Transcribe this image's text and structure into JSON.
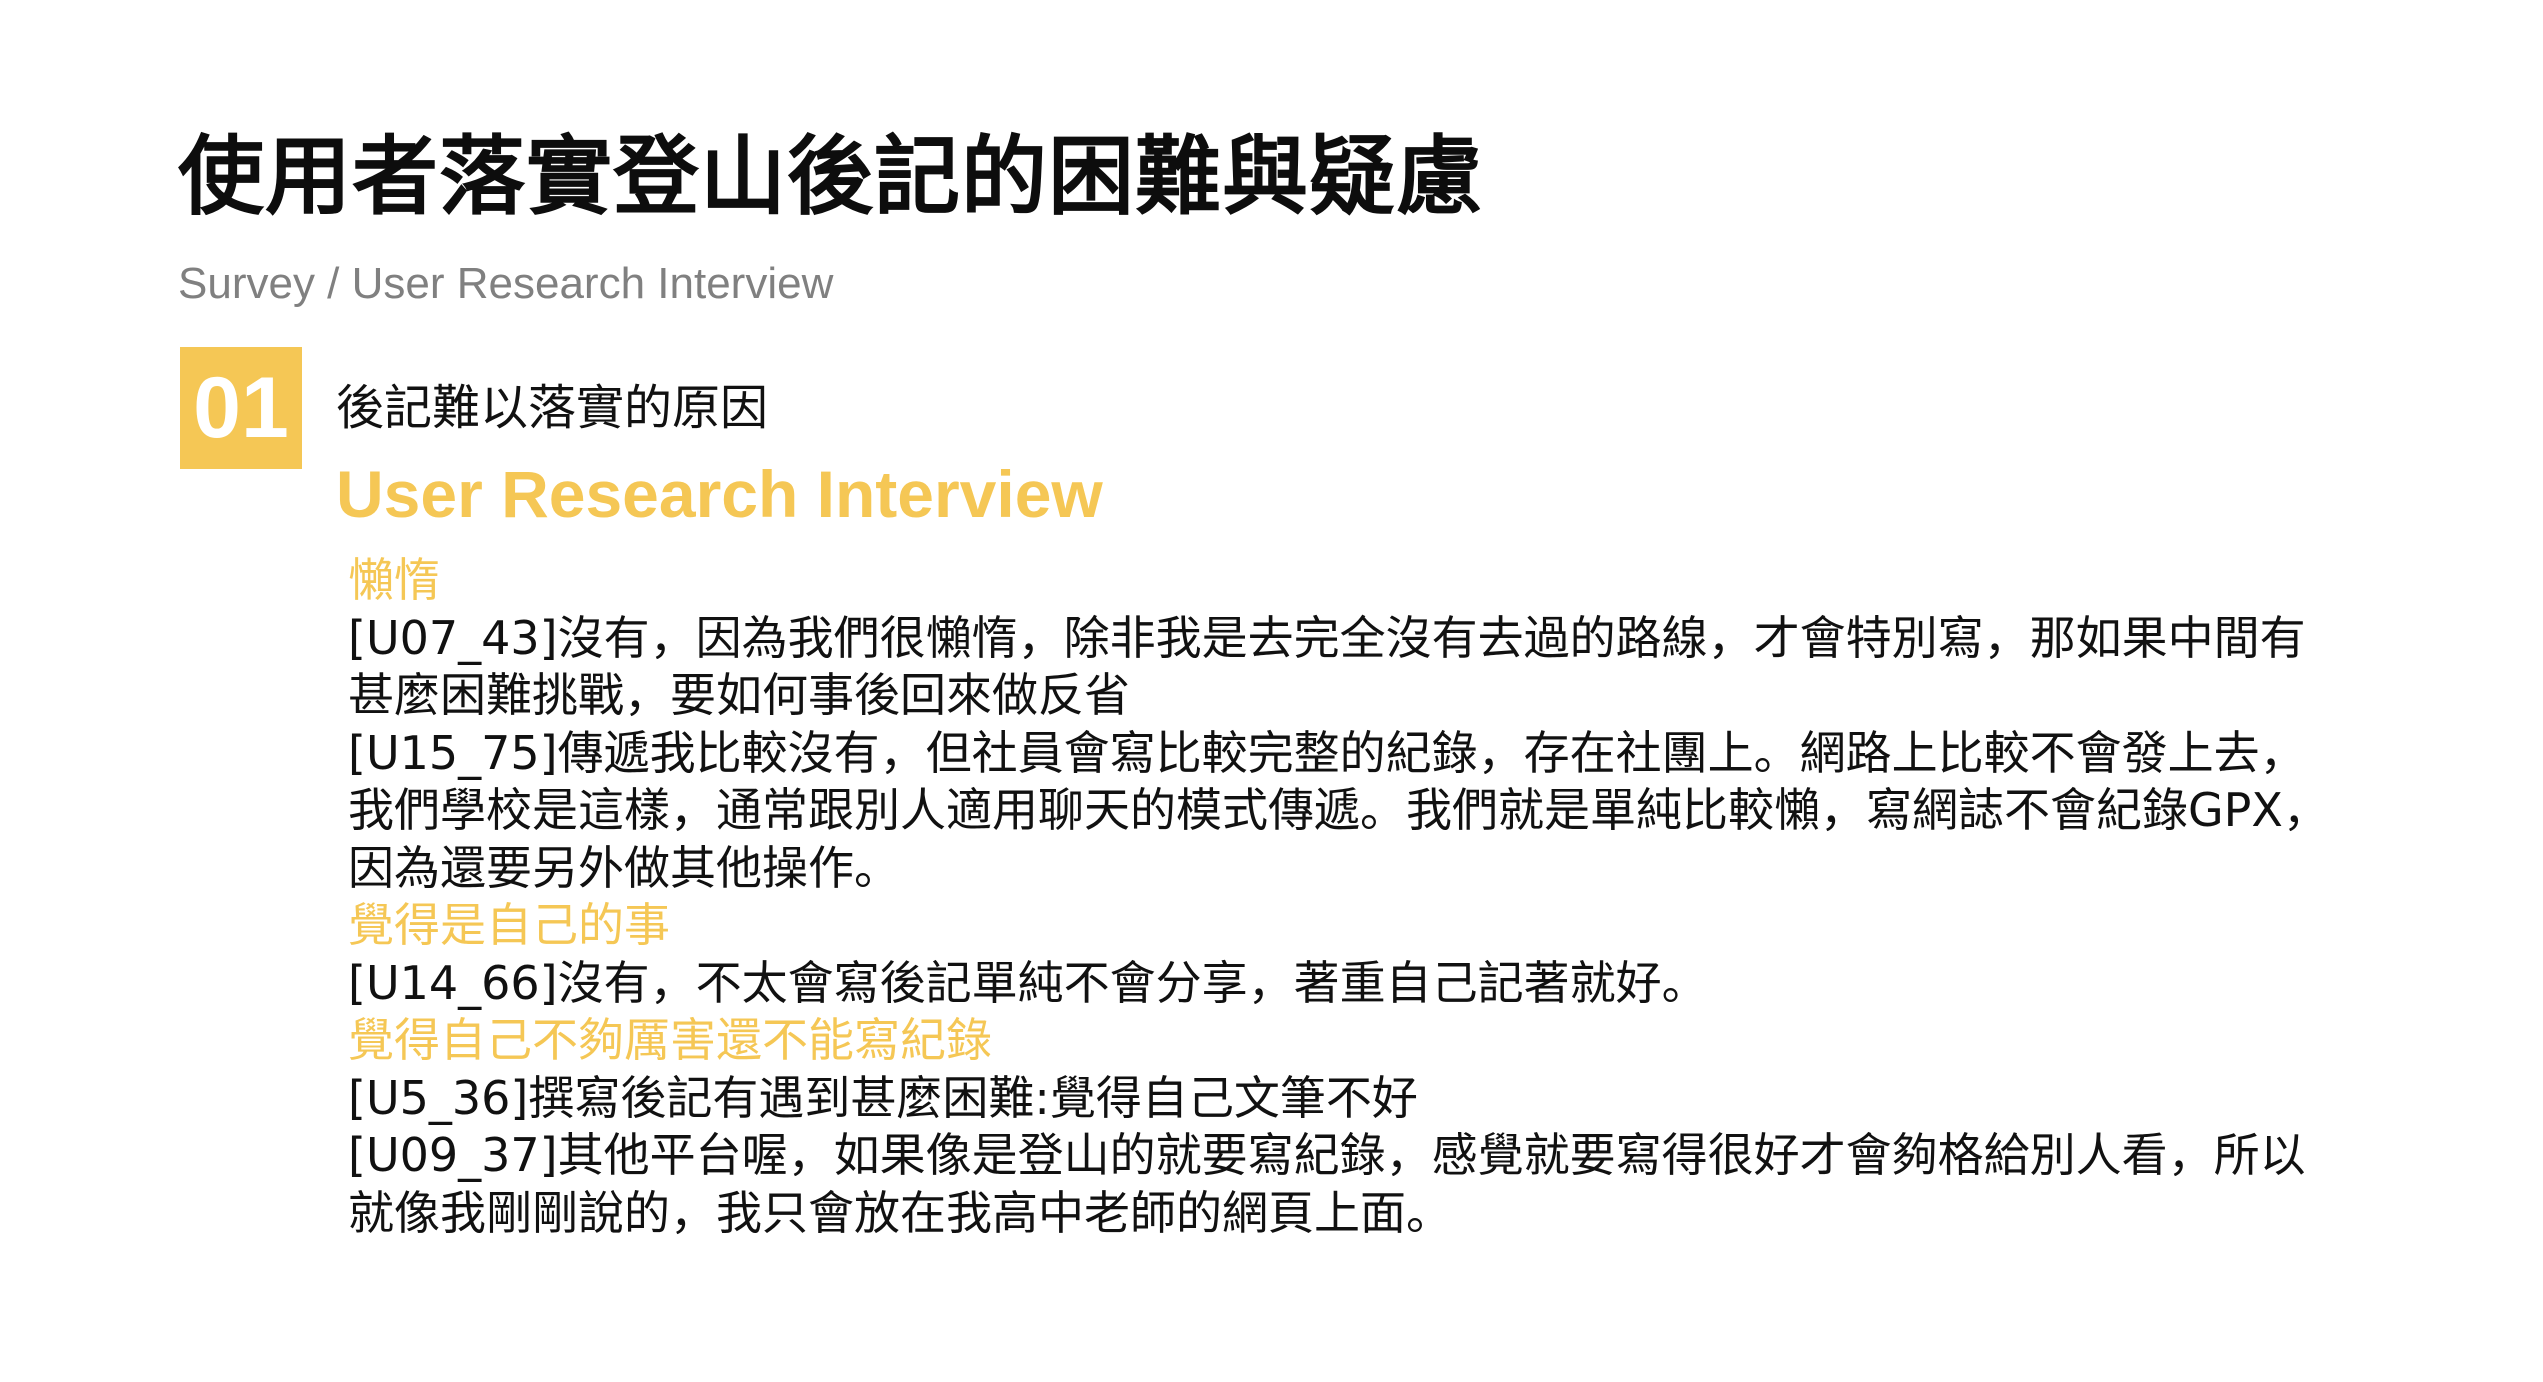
{
  "header": {
    "title": "使用者落實登山後記的困難與疑慮",
    "breadcrumb": "Survey / User Research Interview"
  },
  "section": {
    "number": "01",
    "title": "後記難以落實的原因",
    "subtitle": "User Research Interview"
  },
  "groups": [
    {
      "category": "懶惰",
      "quotes": [
        "[U07_43]沒有，因為我們很懶惰，除非我是去完全沒有去過的路線，才會特別寫，那如果中間有甚麼困難挑戰，要如何事後回來做反省",
        "[U15_75]傳遞我比較沒有，但社員會寫比較完整的紀錄，存在社團上。網路上比較不會發上去，我們學校是這樣，通常跟別人適用聊天的模式傳遞。我們就是單純比較懶，寫網誌不會紀錄GPX，因為還要另外做其他操作。"
      ]
    },
    {
      "category": "覺得是自己的事",
      "quotes": [
        "[U14_66]沒有，不太會寫後記單純不會分享，著重自己記著就好。"
      ]
    },
    {
      "category": "覺得自己不夠厲害還不能寫紀錄",
      "quotes": [
        "[U5_36]撰寫後記有遇到甚麼困難:覺得自己文筆不好",
        "[U09_37]其他平台喔，如果像是登山的就要寫紀錄，感覺就要寫得很好才會夠格給別人看，所以就像我剛剛說的，我只會放在我高中老師的網頁上面。"
      ]
    }
  ],
  "colors": {
    "accent": "#f5c755",
    "title": "#0d0d0d",
    "muted": "#808080"
  }
}
